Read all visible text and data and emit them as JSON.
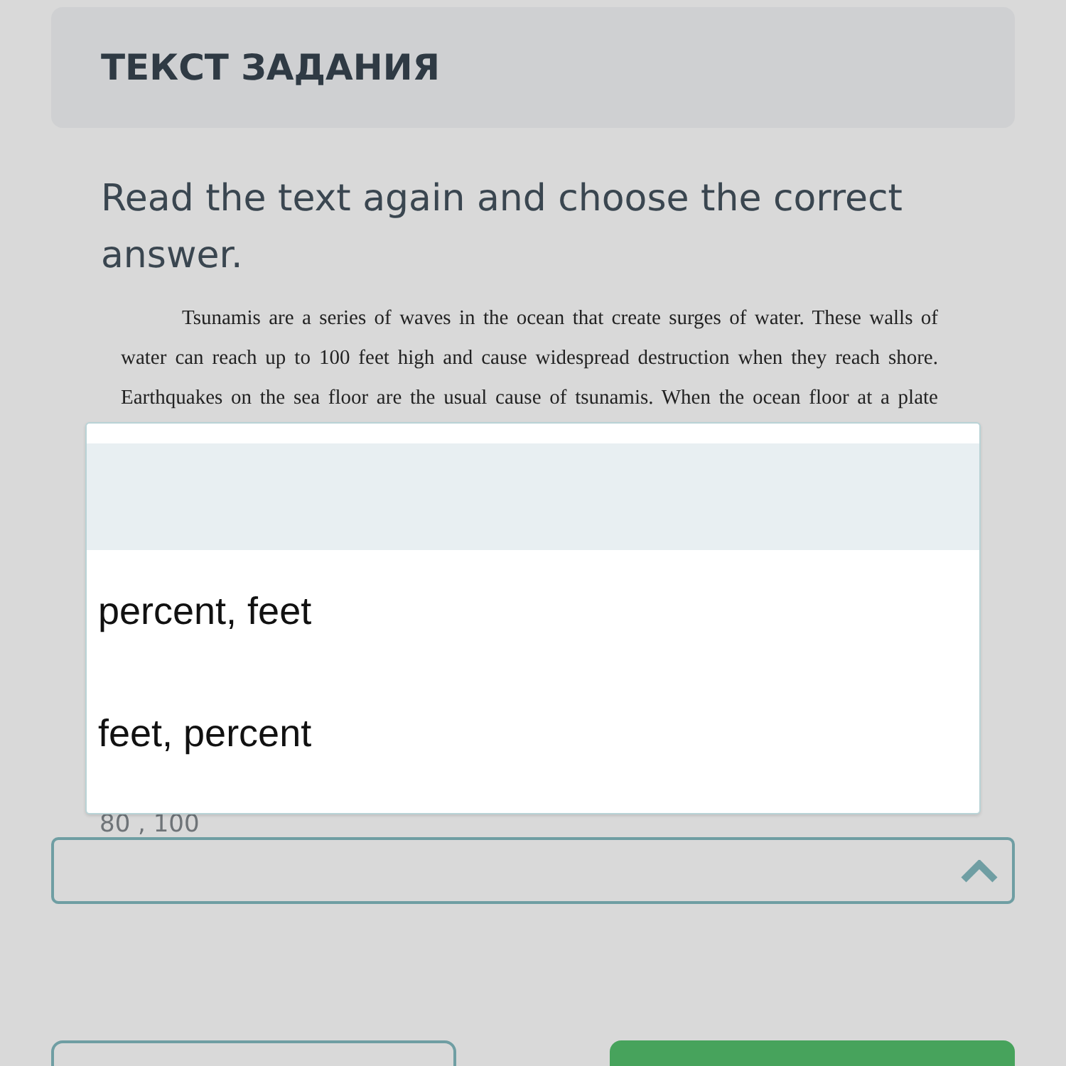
{
  "header": {
    "title": "ТЕКСТ ЗАДАНИЯ"
  },
  "instruction": "Read the text again and choose the correct answer.",
  "passage": {
    "lines": [
      "Tsunamis are a series of waves in the ocean that create surges of water. These walls of",
      "water can reach up to 100 feet high and cause widespread destruction when they reach shore.",
      "Earthquakes on the sea floor are the usual cause of tsunamis. When the ocean floor at a plate"
    ]
  },
  "answer_hint": "80 , 100",
  "select": {
    "expanded": true,
    "options": [
      {
        "kind": "blank",
        "highlighted": true
      },
      {
        "kind": "text",
        "label": "percent, feet",
        "highlighted": false
      },
      {
        "kind": "text",
        "label": "feet, percent",
        "highlighted": false
      }
    ]
  }
}
